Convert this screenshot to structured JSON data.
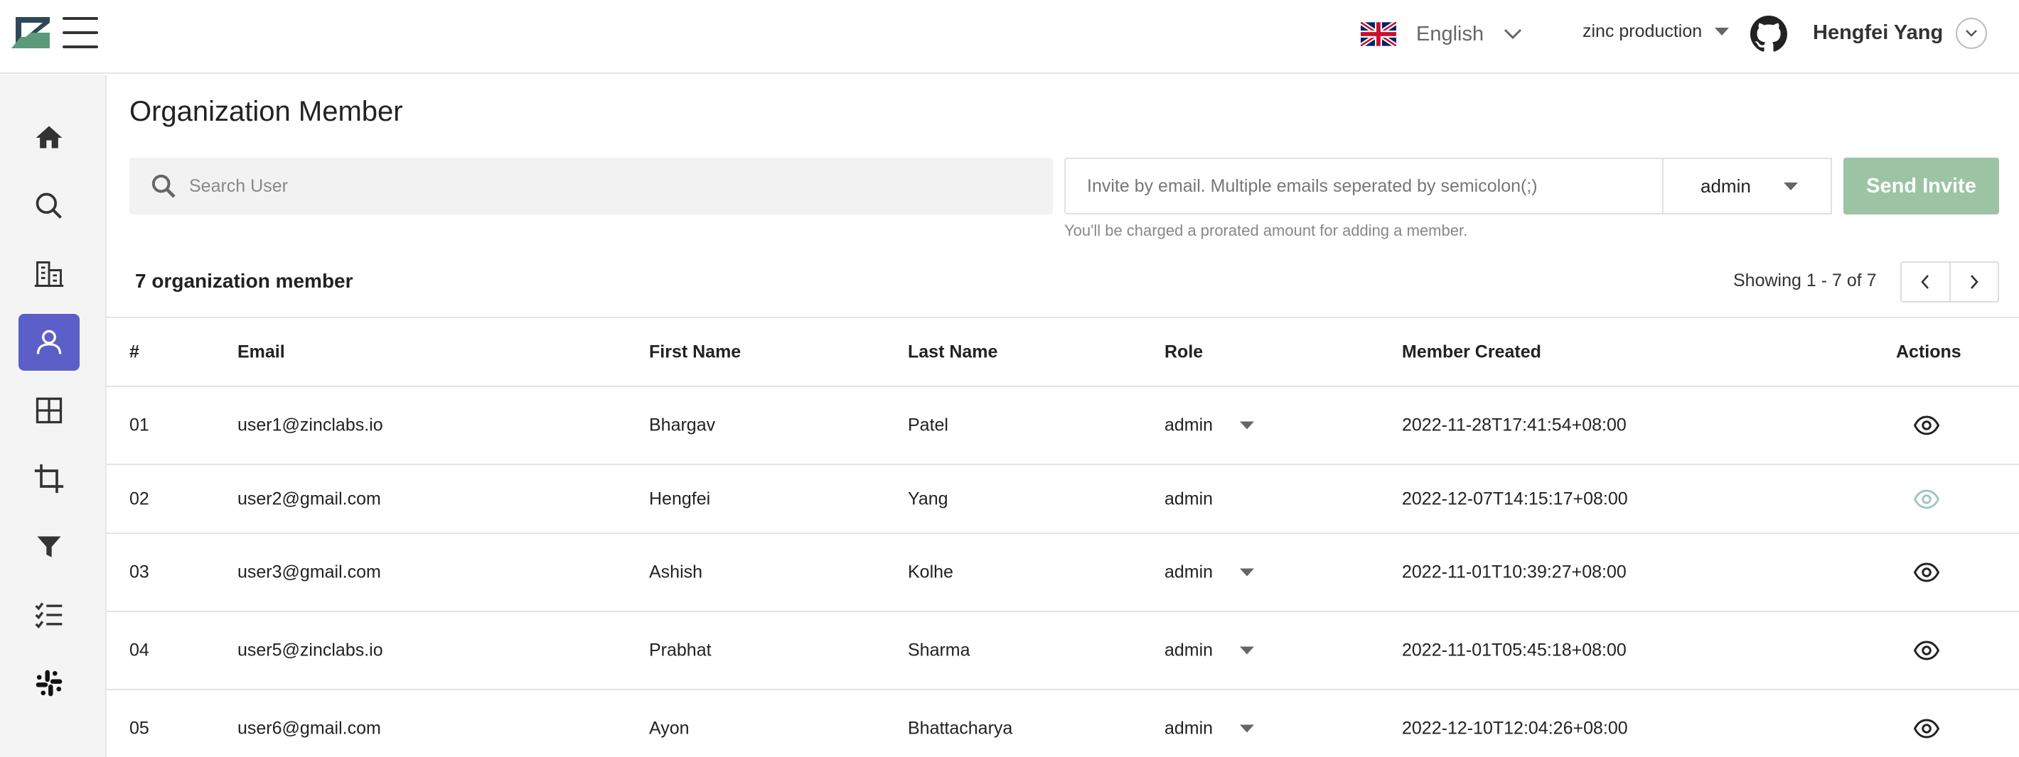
{
  "header": {
    "language": "English",
    "organization": "zinc production",
    "user_name": "Hengfei Yang"
  },
  "sidebar": {
    "items": [
      {
        "name": "home",
        "icon": "home-icon"
      },
      {
        "name": "search",
        "icon": "search-icon"
      },
      {
        "name": "organization",
        "icon": "building-icon"
      },
      {
        "name": "members",
        "icon": "user-icon",
        "active": true
      },
      {
        "name": "dashboards",
        "icon": "grid-icon"
      },
      {
        "name": "ingestion",
        "icon": "crop-icon"
      },
      {
        "name": "functions",
        "icon": "filter-icon"
      },
      {
        "name": "alerts",
        "icon": "checklist-icon"
      },
      {
        "name": "slack",
        "icon": "slack-icon"
      }
    ],
    "active_color": "#5b5fc7"
  },
  "main": {
    "title": "Organization Member",
    "search_placeholder": "Search User",
    "invite_placeholder": "Invite by email. Multiple emails seperated by semicolon(;)",
    "invite_role": "admin",
    "send_invite_label": "Send Invite",
    "hint": "You'll be charged a prorated amount for adding a member.",
    "member_count": "7 organization member",
    "pagination": "Showing 1 - 7 of 7"
  },
  "table": {
    "columns": {
      "num": "#",
      "email": "Email",
      "first": "First Name",
      "last": "Last Name",
      "role": "Role",
      "created": "Member Created",
      "actions": "Actions"
    },
    "rows": [
      {
        "num": "01",
        "email": "user1@zinclabs.io",
        "first": "Bhargav",
        "last": "Patel",
        "role": "admin",
        "created": "2022-11-28T17:41:54+08:00",
        "editable": true
      },
      {
        "num": "02",
        "email": "user2@gmail.com",
        "first": "Hengfei",
        "last": "Yang",
        "role": "admin",
        "created": "2022-12-07T14:15:17+08:00",
        "editable": false
      },
      {
        "num": "03",
        "email": "user3@gmail.com",
        "first": "Ashish",
        "last": "Kolhe",
        "role": "admin",
        "created": "2022-11-01T10:39:27+08:00",
        "editable": true
      },
      {
        "num": "04",
        "email": "user5@zinclabs.io",
        "first": "Prabhat",
        "last": "Sharma",
        "role": "admin",
        "created": "2022-11-01T05:45:18+08:00",
        "editable": true
      },
      {
        "num": "05",
        "email": "user6@gmail.com",
        "first": "Ayon",
        "last": "Bhattacharya",
        "role": "admin",
        "created": "2022-12-10T12:04:26+08:00",
        "editable": true
      }
    ]
  },
  "colors": {
    "send_button": "#9cc4a4",
    "eye_disabled": "#9fc7c0",
    "logo_green": "#5b9a7a",
    "logo_dark": "#2f4858"
  }
}
